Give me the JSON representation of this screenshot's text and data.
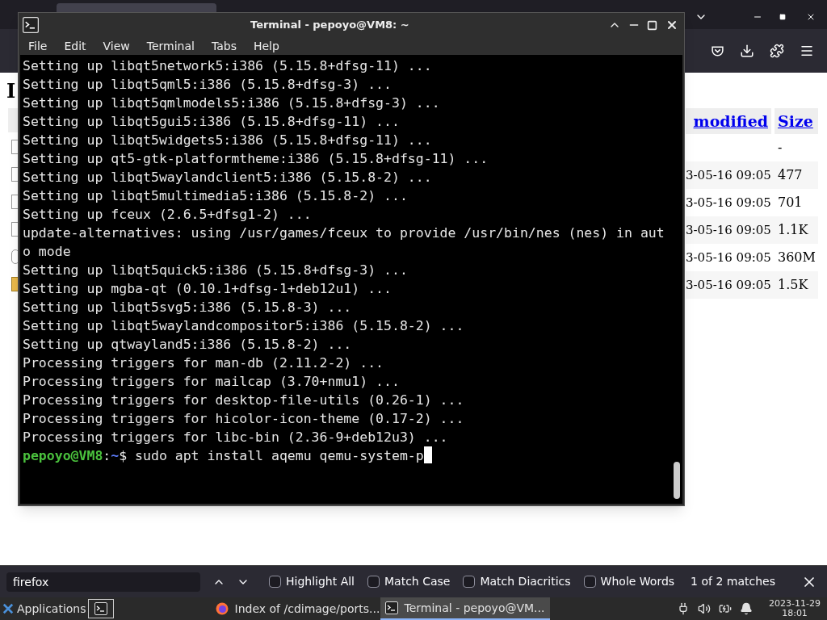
{
  "browser": {
    "heading": "I",
    "table": {
      "columns": [
        "modified",
        "Size"
      ],
      "rows": [
        {
          "modified": "",
          "size": "-"
        },
        {
          "modified": "3-05-16 09:05",
          "size": "477"
        },
        {
          "modified": "3-05-16 09:05",
          "size": "701"
        },
        {
          "modified": "3-05-16 09:05",
          "size": "1.1K"
        },
        {
          "modified": "3-05-16 09:05",
          "size": "360M"
        },
        {
          "modified": "3-05-16 09:05",
          "size": "1.5K"
        }
      ]
    }
  },
  "terminal": {
    "title": "Terminal - pepoyo@VM8: ~",
    "menu": [
      "File",
      "Edit",
      "View",
      "Terminal",
      "Tabs",
      "Help"
    ],
    "lines": [
      "Setting up libqt5network5:i386 (5.15.8+dfsg-11) ...",
      "Setting up libqt5qml5:i386 (5.15.8+dfsg-3) ...",
      "Setting up libqt5qmlmodels5:i386 (5.15.8+dfsg-3) ...",
      "Setting up libqt5gui5:i386 (5.15.8+dfsg-11) ...",
      "Setting up libqt5widgets5:i386 (5.15.8+dfsg-11) ...",
      "Setting up qt5-gtk-platformtheme:i386 (5.15.8+dfsg-11) ...",
      "Setting up libqt5waylandclient5:i386 (5.15.8-2) ...",
      "Setting up libqt5multimedia5:i386 (5.15.8-2) ...",
      "Setting up fceux (2.6.5+dfsg1-2) ...",
      "update-alternatives: using /usr/games/fceux to provide /usr/bin/nes (nes) in auto mode",
      "Setting up libqt5quick5:i386 (5.15.8+dfsg-3) ...",
      "Setting up mgba-qt (0.10.1+dfsg-1+deb12u1) ...",
      "Setting up libqt5svg5:i386 (5.15.8-3) ...",
      "Setting up libqt5waylandcompositor5:i386 (5.15.8-2) ...",
      "Setting up qtwayland5:i386 (5.15.8-2) ...",
      "Processing triggers for man-db (2.11.2-2) ...",
      "Processing triggers for mailcap (3.70+nmu1) ...",
      "Processing triggers for desktop-file-utils (0.26-1) ...",
      "Processing triggers for hicolor-icon-theme (0.17-2) ...",
      "Processing triggers for libc-bin (2.36-9+deb12u3) ..."
    ],
    "prompt": {
      "user": "pepoyo@VM8",
      "sep": ":",
      "path": "~",
      "symbol": "$",
      "command": "sudo apt install aqemu qemu-system-p"
    }
  },
  "find_bar": {
    "value": "firefox",
    "options": [
      {
        "label": "Highlight All",
        "checked": false
      },
      {
        "label": "Match Case",
        "checked": false
      },
      {
        "label": "Match Diacritics",
        "checked": false
      },
      {
        "label": "Whole Words",
        "checked": false
      }
    ],
    "result": "1 of 2 matches"
  },
  "taskbar": {
    "applications": "Applications",
    "tasks": [
      {
        "kind": "browser",
        "label": "Index of /cdimage/ports...",
        "selected": false
      },
      {
        "kind": "terminal",
        "label": "Terminal - pepoyo@VM...",
        "selected": true
      }
    ],
    "date": "2023-11-29",
    "time": "18:01"
  }
}
